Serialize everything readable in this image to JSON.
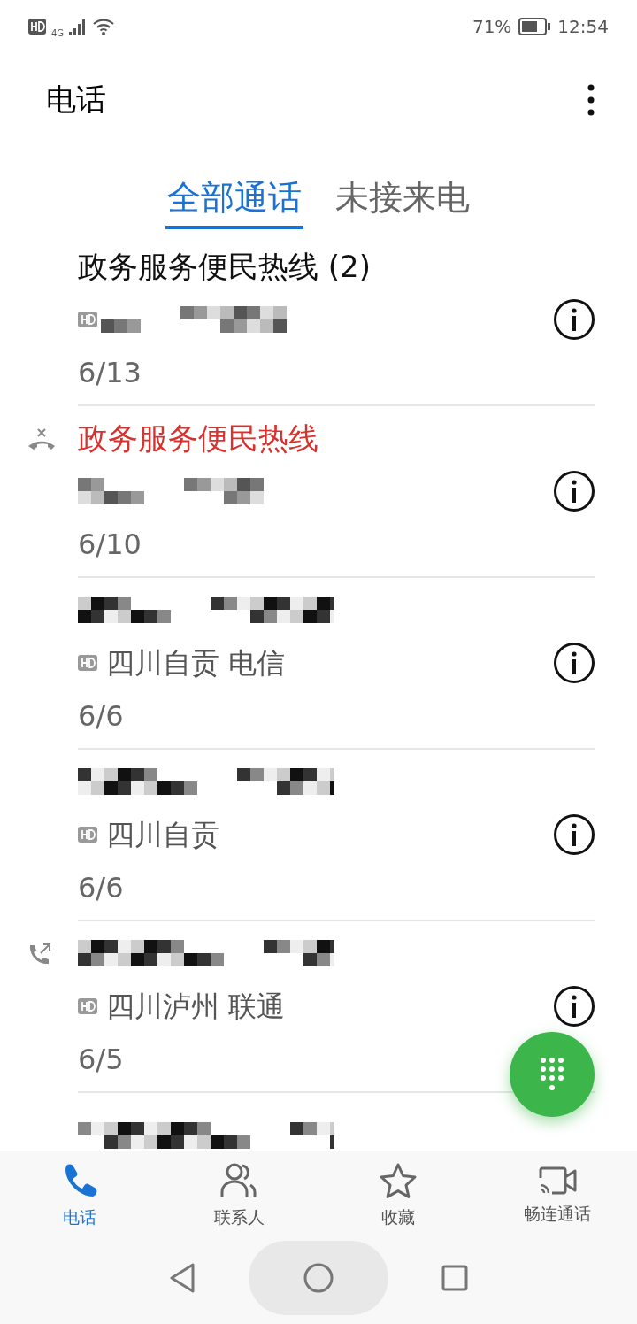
{
  "status_bar": {
    "network": "4G",
    "battery_text": "71%",
    "time": "12:54"
  },
  "header": {
    "title": "电话"
  },
  "tabs": [
    {
      "label": "全部通话",
      "selected": true
    },
    {
      "label": "未接来电",
      "selected": false
    }
  ],
  "calls": [
    {
      "kind": "plain",
      "lines": [
        {
          "kind": "name",
          "text": "政务服务便民热线 (2)",
          "missed": false
        },
        {
          "kind": "redacted",
          "hd": true
        },
        {
          "kind": "date",
          "text": "6/13"
        }
      ]
    },
    {
      "kind": "missed",
      "lines": [
        {
          "kind": "name",
          "text": "政务服务便民热线",
          "missed": true
        },
        {
          "kind": "redacted",
          "hd": false
        },
        {
          "kind": "date",
          "text": "6/10"
        }
      ]
    },
    {
      "kind": "plain",
      "lines": [
        {
          "kind": "redacted",
          "hd": false
        },
        {
          "kind": "location",
          "text": "四川自贡 电信",
          "hd": true
        },
        {
          "kind": "date",
          "text": "6/6"
        }
      ]
    },
    {
      "kind": "plain",
      "lines": [
        {
          "kind": "redacted",
          "hd": false
        },
        {
          "kind": "location",
          "text": "四川自贡",
          "hd": true
        },
        {
          "kind": "date",
          "text": "6/6"
        }
      ]
    },
    {
      "kind": "outgoing",
      "lines": [
        {
          "kind": "redacted",
          "hd": false
        },
        {
          "kind": "location",
          "text": "四川泸州 联通",
          "hd": true
        },
        {
          "kind": "date",
          "text": "6/5"
        }
      ]
    },
    {
      "kind": "plain",
      "lines": [
        {
          "kind": "redacted",
          "hd": false
        }
      ]
    }
  ],
  "bottom_nav": [
    {
      "label": "电话",
      "selected": true
    },
    {
      "label": "联系人",
      "selected": false
    },
    {
      "label": "收藏",
      "selected": false
    },
    {
      "label": "畅连通话",
      "selected": false
    }
  ]
}
